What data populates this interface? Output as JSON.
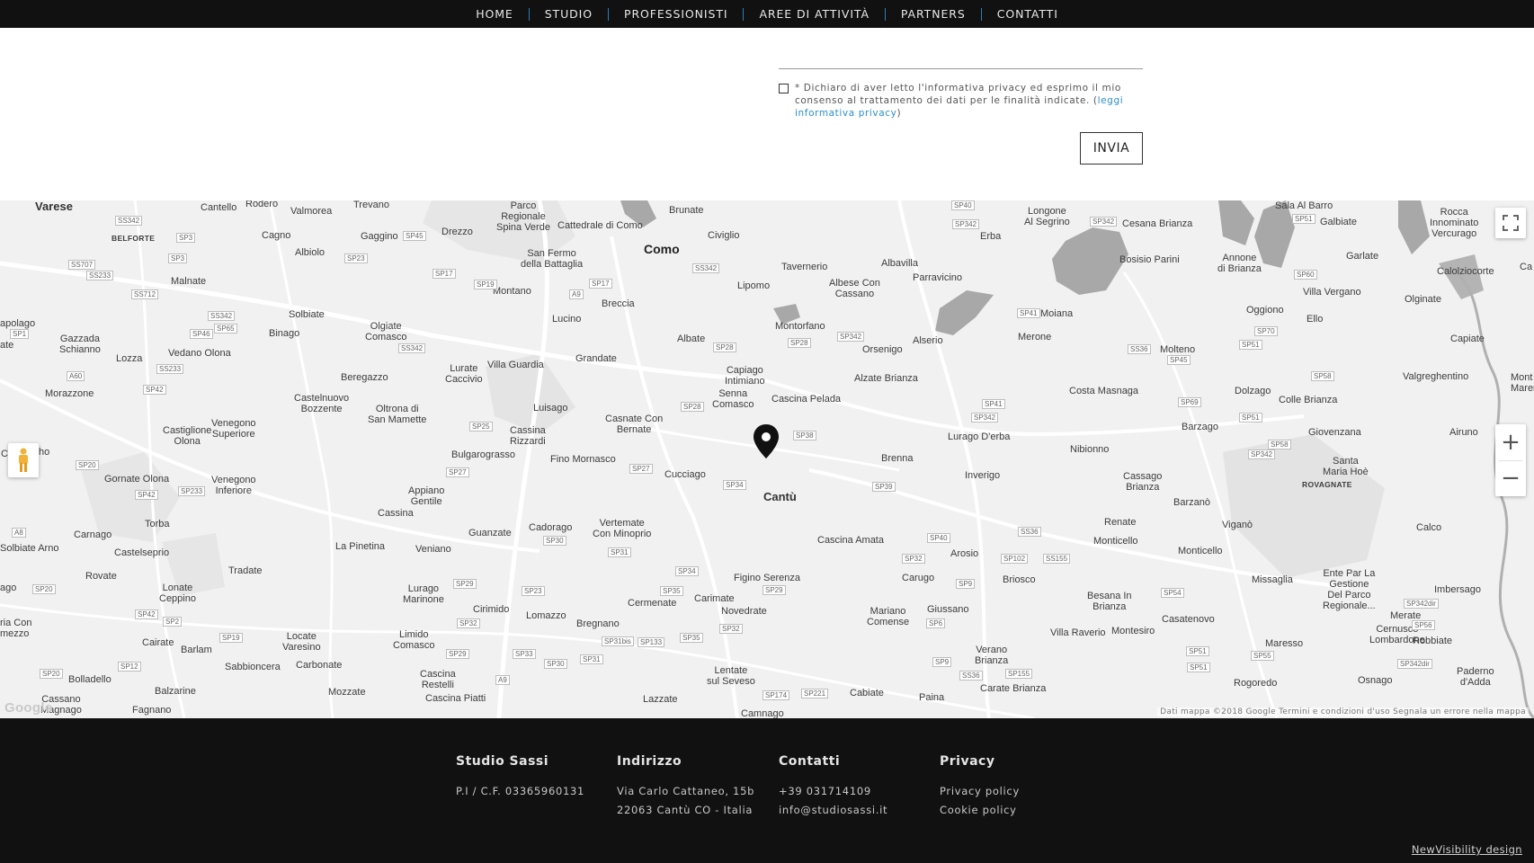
{
  "nav": {
    "items": [
      {
        "label": "HOME"
      },
      {
        "label": "STUDIO"
      },
      {
        "label": "PROFESSIONISTI"
      },
      {
        "label": "AREE DI ATTIVITÀ"
      },
      {
        "label": "PARTNERS"
      },
      {
        "label": "CONTATTI"
      }
    ]
  },
  "form": {
    "consent_text": "* Dichiaro di aver letto l'informativa privacy ed esprimo il mio consenso al trattamento dei dati per le finalità indicate. (",
    "consent_link": "leggi informativa privacy",
    "consent_close": ")",
    "submit_label": "INVIA",
    "consent_checked": false
  },
  "map": {
    "places": {
      "varese": "Varese",
      "cantello": "Cantello",
      "rodero": "Rodero",
      "valmorea": "Valmorea",
      "trevano": "Trevano",
      "parco": "Parco\nRegionale\nSpina Verde",
      "cattedrale": "Cattedrale di Como",
      "brunate": "Brunate",
      "como": "Como",
      "belforte": "BELFORTE",
      "cagno": "Cagno",
      "gaggino": "Gaggino",
      "drezzo": "Drezzo",
      "civiglio": "Civiglio",
      "albiolo": "Albiolo",
      "sanfermo": "San Fermo\ndella Battaglia",
      "tavernerio": "Tavernerio",
      "albavilla": "Albavilla",
      "erba": "Erba",
      "longone": "Longone\nAl Segrino",
      "cesana": "Cesana Brianza",
      "sala": "Sala Al Barro",
      "galbiate": "Galbiate",
      "rocca": "Rocca\nInnominato\nVercurago",
      "malnate": "Malnate",
      "montano": "Montano",
      "lipomo": "Lipomo",
      "albese": "Albese Con\nCassano",
      "parravicino": "Parravicino",
      "bosisio": "Bosisio Parini",
      "annone": "Annone\ndi Brianza",
      "garlate": "Garlate",
      "calolzio": "Calolziocorte",
      "breccia": "Breccia",
      "solbiate": "Solbiate",
      "binago": "Binago",
      "olgiate": "Olgiate\nComasco",
      "lucino": "Lucino",
      "montorfano": "Montorfano",
      "moiana": "Moiana",
      "merone": "Merone",
      "oggiono": "Oggiono",
      "vergano": "Villa Vergano",
      "ello": "Ello",
      "olginate": "Olginate",
      "apolago": "apolago",
      "gazzada": "Gazzada\nSchianno",
      "lozza": "Lozza",
      "vedano": "Vedano Olona",
      "lurate": "Lurate\nCaccivio",
      "villaguardia": "Villa Guardia",
      "grandate": "Grandate",
      "albate": "Albate",
      "capiago": "Capiago\nIntimiano",
      "orsenigo": "Orsenigo",
      "alserio": "Alserio",
      "molteno": "Molteno",
      "capiate": "Capiate",
      "beregazzo": "Beregazzo",
      "alzate": "Alzate Brianza",
      "costa": "Costa Masnaga",
      "dolzago": "Dolzago",
      "valgreghentino": "Valgreghentino",
      "colle": "Colle Brianza",
      "morazzone": "Morazzone",
      "castelnuovo": "Castelnuovo\nBozzente",
      "oltrona": "Oltrona di\nSan Mamette",
      "luisago": "Luisago",
      "senna": "Senna\nComasco",
      "cascinapelada": "Cascina Pelada",
      "castiglione": "Castiglione\nOlona",
      "venegono_sup": "Venegono\nSuperiore",
      "cassinarizzardi": "Cassina\nRizzardi",
      "casnate": "Casnate Con\nBernate",
      "lurago": "Lurago D'erba",
      "barzago": "Barzago",
      "airuno": "Airuno",
      "giovenzana": "Giovenzana",
      "bulgarograsso": "Bulgarograsso",
      "finomornasco": "Fino Mornasco",
      "brenna": "Brenna",
      "nibionno": "Nibionno",
      "santamaria": "Santa\nMaria Hoè",
      "rovagnate": "ROVAGNATE",
      "gornate": "Gornate Olona",
      "venegono_inf": "Venegono\nInferiore",
      "appiano": "Appiano\nGentile",
      "cucciago": "Cucciago",
      "inverigo": "Inverigo",
      "cassago": "Cassago\nBrianza",
      "cantu": "Cantù",
      "barzano": "Barzanò",
      "cassina": "Cassina",
      "torba": "Torba",
      "carnago": "Carnago",
      "guanzate": "Guanzate",
      "cadorago": "Cadorago",
      "vertemate": "Vertemate\nCon Minoprio",
      "renate": "Renate",
      "vigano": "Viganò",
      "calco": "Calco",
      "solbiatearno": "Solbiate Arno",
      "castelseprio": "Castelseprio",
      "lapinetina": "La Pinetina",
      "veniano": "Veniano",
      "cascinaamata": "Cascina Amata",
      "arosio": "Arosio",
      "monticello": "Monticello",
      "monticello2": "Monticello",
      "tradate": "Tradate",
      "rovate": "Rovate",
      "figino": "Figino Serenza",
      "carugo": "Carugo",
      "briosco": "Briosco",
      "missaglia": "Missaglia",
      "entepar": "Ente Par La\nGestione\nDel Parco\nRegionale...",
      "imbersago": "Imbersago",
      "lonate": "Lonate\nCeppino",
      "luragomarinone": "Lurago\nMarinone",
      "cirimido": "Cirimido",
      "cermenate": "Cermenate",
      "carimate": "Carimate",
      "novedrate": "Novedrate",
      "besana": "Besana In\nBrianza",
      "merate": "Merate",
      "cernusco": "Cernusco\nLombardone",
      "giussano": "Giussano",
      "mariano": "Mariano\nComense",
      "lomazzo": "Lomazzo",
      "cairate": "Cairate",
      "barlam": "Barlam",
      "locate": "Locate\nVaresino",
      "limido": "Limido\nComasco",
      "bregnano": "Bregnano",
      "villaraverio": "Villa Raverio",
      "montesiro": "Montesiro",
      "casatenovo": "Casatenovo",
      "maresso": "Maresso",
      "robbiate": "Robbiate",
      "sabbioncera": "Sabbioncera",
      "carbonate": "Carbonate",
      "verano": "Verano\nBrianza",
      "bolladello": "Bolladello",
      "cascinarestelli": "Cascina\nRestelli",
      "lentate": "Lentate\nsul Seveso",
      "osnago": "Osnago",
      "padernod": "Paderno\nd'Adda",
      "balzarine": "Balzarine",
      "mozzate": "Mozzate",
      "cabiate": "Cabiate",
      "paina": "Paina",
      "carate": "Carate Brianza",
      "rogoredo": "Rogoredo",
      "cassano": "Cassano\nMagnago",
      "fagnano": "Fagnano",
      "cascinapiatti": "Cascina Piatti",
      "lazzate": "Lazzate",
      "camnago": "Camnago",
      "aircon": "ria Con\nmezzo",
      "ago": "ago",
      "solbiate_c": "C",
      "ho": "ho",
      "ate": "ate",
      "ca": "Ca",
      "mont": "Mont\nMaren",
      "e": "E"
    },
    "roads": [
      "SS342",
      "SP3",
      "SP3",
      "SS707",
      "SS233",
      "SS712",
      "SS342",
      "SP65",
      "SP46",
      "SS342",
      "SP1",
      "A60",
      "SS233",
      "SP42",
      "SP23",
      "SP45",
      "SP17",
      "SP19",
      "SP17",
      "A9",
      "SS342",
      "SP342",
      "SP28",
      "SP28",
      "SP342",
      "SP41",
      "SS36",
      "SP45",
      "SP51",
      "SP70",
      "SP60",
      "SP51",
      "SP58",
      "SP69",
      "SP41",
      "SP342",
      "SP51",
      "SP342",
      "SP58",
      "SP28",
      "SP25",
      "SP38",
      "SP27",
      "SP27",
      "SP34",
      "SP39",
      "SP20",
      "SP42",
      "SP233",
      "A8",
      "SP30",
      "SP31",
      "SS36",
      "SP40",
      "SP32",
      "SS155",
      "SP102",
      "SP9",
      "SP20",
      "SP29",
      "SP23",
      "SP34",
      "SP35",
      "SP29",
      "SP54",
      "SP342dir",
      "SP42",
      "SP2",
      "SP32",
      "SP19",
      "SP29",
      "SP33",
      "SP31bis",
      "SP133",
      "SP35",
      "SP32",
      "SP6",
      "SP51",
      "SP55",
      "SP56",
      "SP342dir",
      "SP12",
      "SP20",
      "SP30",
      "SP31",
      "SP174",
      "SP221",
      "SP9",
      "SS36",
      "SP155",
      "SP51",
      "A9",
      "SP40",
      "SP342"
    ],
    "attribution": "Dati mappa ©2018 Google   Termini e condizioni d'uso   Segnala un errore nella mappa",
    "logo": "Google"
  },
  "footer": {
    "studio": {
      "title": "Studio Sassi",
      "line1": "P.I / C.F. 03365960131"
    },
    "indirizzo": {
      "title": "Indirizzo",
      "line1": "Via Carlo Cattaneo, 15b",
      "line2": "22063 Cantù CO - Italia"
    },
    "contatti": {
      "title": "Contatti",
      "phone": "+39 031714109",
      "email": "info@studiosassi.it"
    },
    "privacy": {
      "title": "Privacy",
      "link1": "Privacy policy",
      "link2": "Cookie policy"
    },
    "credit": "NewVisibility design"
  },
  "colors": {
    "dark": "#111111",
    "accent": "#2d7fb8",
    "link": "#2b8fc9",
    "map_bg": "#f1f1f1",
    "water": "#a8a8a8"
  }
}
